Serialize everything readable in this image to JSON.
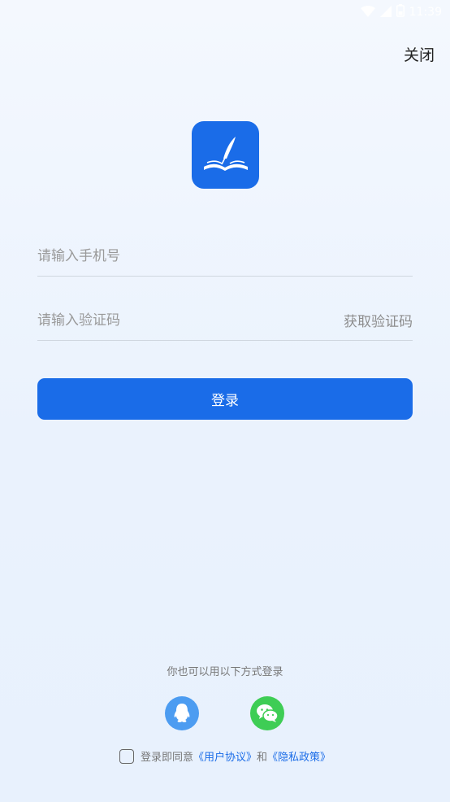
{
  "statusbar": {
    "time": "11:39"
  },
  "header": {
    "close_label": "关闭"
  },
  "form": {
    "phone_placeholder": "请输入手机号",
    "code_placeholder": "请输入验证码",
    "get_code_label": "获取验证码",
    "login_label": "登录"
  },
  "other_login": {
    "title": "你也可以用以下方式登录",
    "qq_icon": "qq-icon",
    "wechat_icon": "wechat-icon"
  },
  "agreement": {
    "prefix": "登录即同意",
    "user_agreement": "《用户协议》",
    "conj": "和",
    "privacy_policy": "《隐私政策》"
  },
  "colors": {
    "accent": "#1a6ce8",
    "qq": "#4c9cf1",
    "wechat": "#3ecd55"
  }
}
